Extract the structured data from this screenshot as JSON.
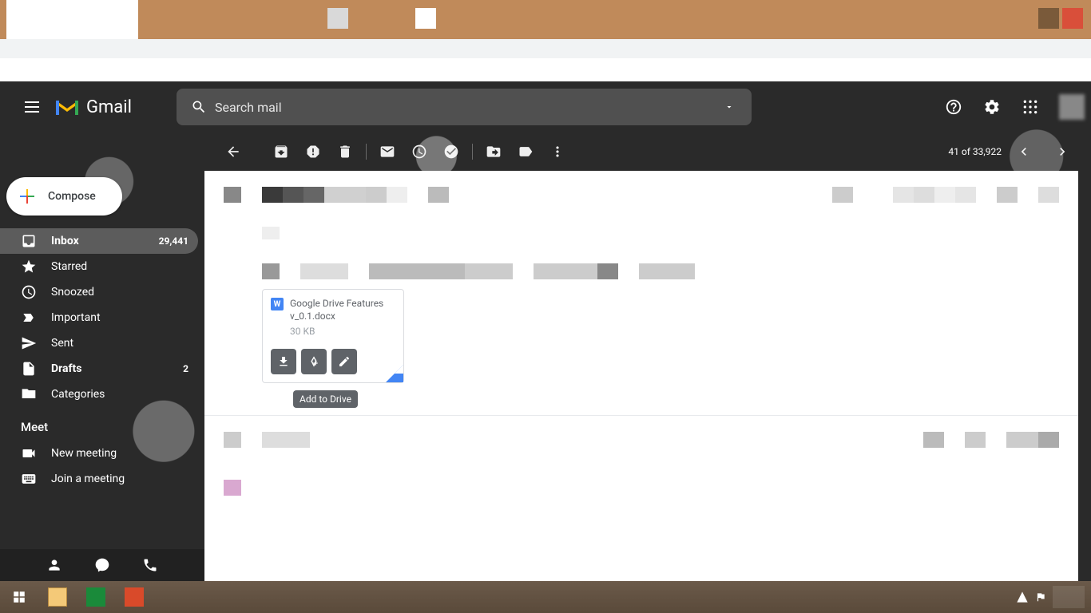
{
  "app_name": "Gmail",
  "search": {
    "placeholder": "Search mail"
  },
  "compose_label": "Compose",
  "nav": {
    "inbox": {
      "label": "Inbox",
      "count": "29,441"
    },
    "starred": "Starred",
    "snoozed": "Snoozed",
    "important": "Important",
    "sent": "Sent",
    "drafts": {
      "label": "Drafts",
      "count": "2"
    },
    "categories": "Categories"
  },
  "meet": {
    "header": "Meet",
    "new_meeting": "New meeting",
    "join_meeting": "Join a meeting"
  },
  "pager": {
    "position": "41",
    "of_word": "of",
    "total": "33,922"
  },
  "attachment": {
    "name": "Google Drive Features v_0.1.docx",
    "size": "30 KB",
    "word_letter": "W"
  },
  "tooltip": "Add to Drive",
  "icons": {
    "menu": "menu-icon",
    "search": "search-icon",
    "dropdown": "caret-down-icon",
    "help": "help-icon",
    "settings": "gear-icon",
    "apps": "apps-grid-icon",
    "back": "arrow-left-icon",
    "archive": "archive-icon",
    "spam": "report-spam-icon",
    "delete": "trash-icon",
    "unread": "mark-unread-icon",
    "snooze": "clock-icon",
    "task": "add-task-icon",
    "move": "move-to-icon",
    "label": "label-icon",
    "more": "more-vert-icon",
    "prev": "chevron-left-icon",
    "next": "chevron-right-icon",
    "download": "download-icon",
    "drive_add": "drive-add-icon",
    "edit": "pencil-icon"
  }
}
